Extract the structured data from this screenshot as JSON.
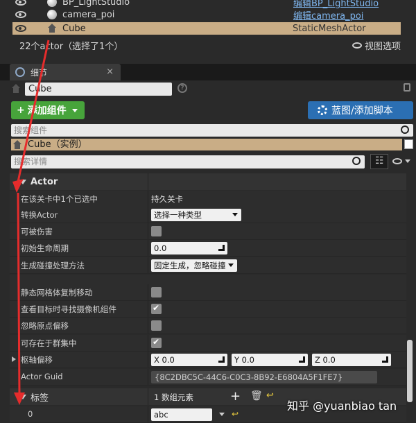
{
  "outliner": {
    "rows": [
      {
        "name": "BP_LightStudio",
        "type": "编辑BP_LightStudio"
      },
      {
        "name": "camera_poi",
        "type": "编辑camera_poi"
      },
      {
        "name": "Cube",
        "type": "StaticMeshActor"
      }
    ],
    "actor_count": "22个actor（选择了1个）",
    "view_options": "视图选项"
  },
  "details": {
    "tab_label": "细节",
    "close": "×",
    "name_value": "Cube",
    "help": "?",
    "add_component": "添加组件",
    "add_plus": "+",
    "blueprint_button": "蓝图/添加脚本",
    "search_components_placeholder": "搜索组件",
    "instance_label": "Cube（实例）",
    "search_details_placeholder": "搜索详情"
  },
  "actor_category": {
    "title": "Actor",
    "rows": [
      {
        "label": "在该关卡中1个已选中",
        "value": "持久关卡"
      },
      {
        "label": "转换Actor",
        "value": "选择一种类型"
      },
      {
        "label": "可被伤害",
        "value": ""
      },
      {
        "label": "初始生命周期",
        "value": "0.0"
      },
      {
        "label": "生成碰撞处理方法",
        "value": "固定生成，忽略碰撞"
      },
      {
        "label": "静态网格体复制移动",
        "value": ""
      },
      {
        "label": "查看目标时寻找摄像机组件",
        "value": ""
      },
      {
        "label": "忽略原点偏移",
        "value": ""
      },
      {
        "label": "可存在于群集中",
        "value": ""
      },
      {
        "label": "枢轴偏移",
        "x": "X  0.0",
        "y": "Y  0.0",
        "z": "Z  0.0"
      },
      {
        "label": "Actor Guid",
        "value": "{8C2DBC5C-44C6-C0C3-8B92-E6804A5F1FE7}"
      }
    ],
    "checkboxes": {
      "can_be_damaged": false,
      "static_mesh_replicate": false,
      "find_camera": true,
      "ignore_origin_shift": false,
      "can_be_in_cluster": true
    }
  },
  "tags_category": {
    "title": "标签",
    "element_count": "1 数组元素",
    "index": "0",
    "value": "abc"
  },
  "watermark": "知乎 @yuanbiao tan"
}
